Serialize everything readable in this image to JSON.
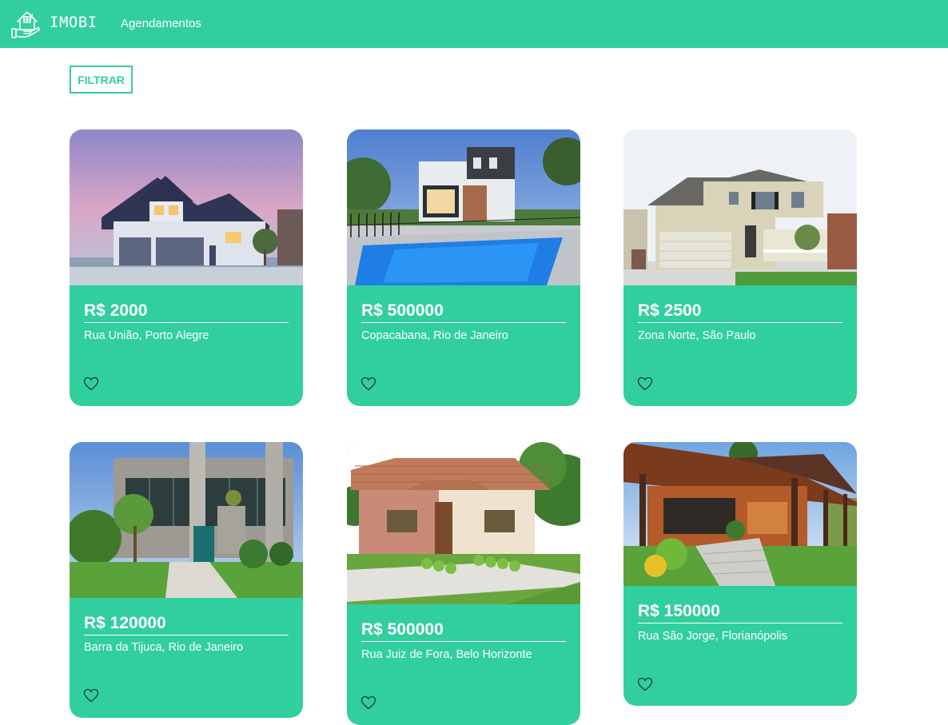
{
  "header": {
    "brand": "IMOBI",
    "nav_link": "Agendamentos",
    "logo_icon": "house-hand-icon",
    "background": "#31cf9d"
  },
  "toolbar": {
    "filter_label": "FILTRAR"
  },
  "accent_color": "#31cf9d",
  "listings": [
    {
      "price": "R$ 2000",
      "address": "Rua União, Porto Alegre",
      "favorite_icon": "heart-outline-icon",
      "image": "blue-gray two-story house at dusk"
    },
    {
      "price": "R$ 500000",
      "address": "Copacabana, Rio de Janeiro",
      "favorite_icon": "heart-outline-icon",
      "image": "modern house with pool"
    },
    {
      "price": "R$ 2500",
      "address": "Zona Norte, São Paulo",
      "favorite_icon": "heart-outline-icon",
      "image": "beige suburban house with garage"
    },
    {
      "price": "R$ 120000",
      "address": "Barra da Tijuca, Rio de Janeiro",
      "favorite_icon": "heart-outline-icon",
      "image": "modern concrete house with garden"
    },
    {
      "price": "R$ 500000",
      "address": "Rua Juiz de Fora, Belo Horizonte",
      "favorite_icon": "heart-outline-icon",
      "image": "small single-story house with tile roof"
    },
    {
      "price": "R$ 150000",
      "address": "Rua São Jorge, Florianópolis",
      "favorite_icon": "heart-outline-icon",
      "image": "wooden country house with veranda"
    }
  ]
}
